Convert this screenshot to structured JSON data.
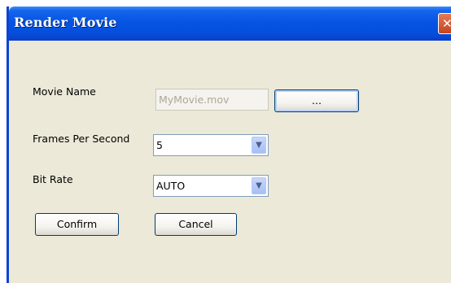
{
  "window": {
    "title": "Render Movie",
    "close_glyph": "✕"
  },
  "form": {
    "movie_name": {
      "label": "Movie Name",
      "value": "MyMovie.mov",
      "browse_label": "..."
    },
    "fps": {
      "label": "Frames Per Second",
      "value": "5"
    },
    "bit_rate": {
      "label": "Bit Rate",
      "value": "AUTO"
    }
  },
  "buttons": {
    "confirm": "Confirm",
    "cancel": "Cancel"
  },
  "colors": {
    "titlebar": "#0654e4",
    "panel": "#ece9d8",
    "close": "#c6431f"
  },
  "icons": {
    "combo_arrow": "chevron-down-icon",
    "close": "close-icon"
  }
}
